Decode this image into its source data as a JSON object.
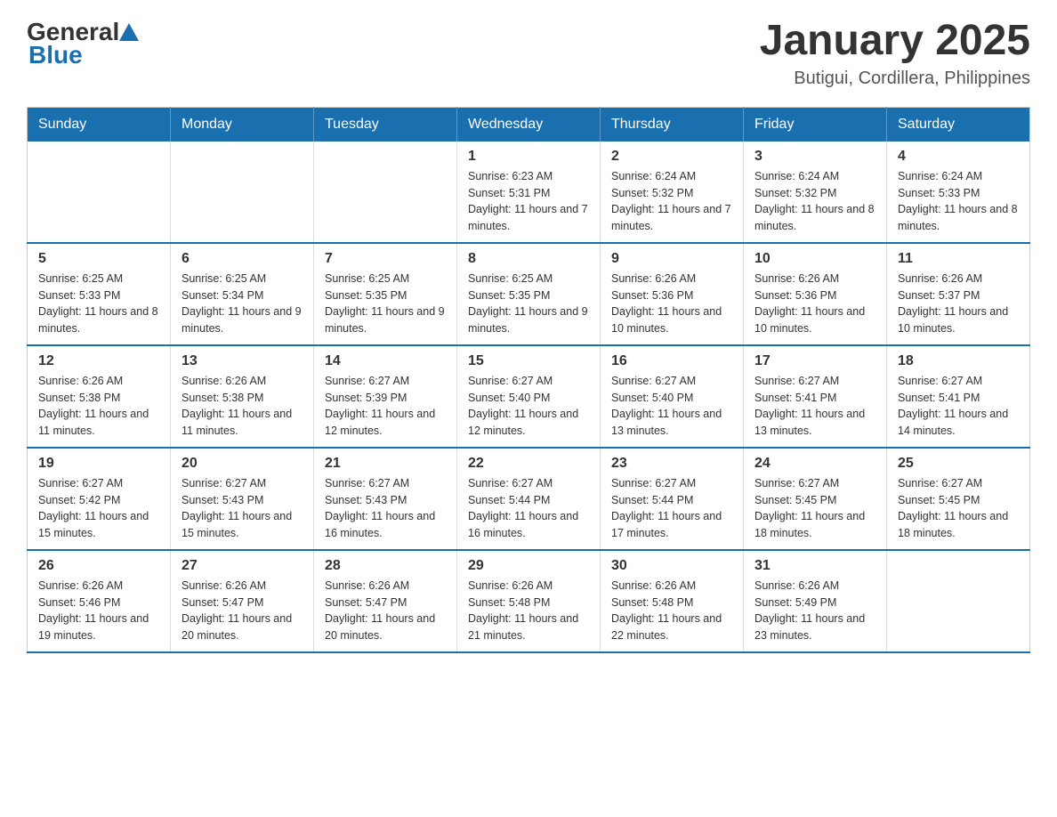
{
  "header": {
    "logo_general": "General",
    "logo_blue": "Blue",
    "month_title": "January 2025",
    "location": "Butigui, Cordillera, Philippines"
  },
  "days_of_week": [
    "Sunday",
    "Monday",
    "Tuesday",
    "Wednesday",
    "Thursday",
    "Friday",
    "Saturday"
  ],
  "weeks": [
    [
      {
        "day": "",
        "info": ""
      },
      {
        "day": "",
        "info": ""
      },
      {
        "day": "",
        "info": ""
      },
      {
        "day": "1",
        "info": "Sunrise: 6:23 AM\nSunset: 5:31 PM\nDaylight: 11 hours and 7 minutes."
      },
      {
        "day": "2",
        "info": "Sunrise: 6:24 AM\nSunset: 5:32 PM\nDaylight: 11 hours and 7 minutes."
      },
      {
        "day": "3",
        "info": "Sunrise: 6:24 AM\nSunset: 5:32 PM\nDaylight: 11 hours and 8 minutes."
      },
      {
        "day": "4",
        "info": "Sunrise: 6:24 AM\nSunset: 5:33 PM\nDaylight: 11 hours and 8 minutes."
      }
    ],
    [
      {
        "day": "5",
        "info": "Sunrise: 6:25 AM\nSunset: 5:33 PM\nDaylight: 11 hours and 8 minutes."
      },
      {
        "day": "6",
        "info": "Sunrise: 6:25 AM\nSunset: 5:34 PM\nDaylight: 11 hours and 9 minutes."
      },
      {
        "day": "7",
        "info": "Sunrise: 6:25 AM\nSunset: 5:35 PM\nDaylight: 11 hours and 9 minutes."
      },
      {
        "day": "8",
        "info": "Sunrise: 6:25 AM\nSunset: 5:35 PM\nDaylight: 11 hours and 9 minutes."
      },
      {
        "day": "9",
        "info": "Sunrise: 6:26 AM\nSunset: 5:36 PM\nDaylight: 11 hours and 10 minutes."
      },
      {
        "day": "10",
        "info": "Sunrise: 6:26 AM\nSunset: 5:36 PM\nDaylight: 11 hours and 10 minutes."
      },
      {
        "day": "11",
        "info": "Sunrise: 6:26 AM\nSunset: 5:37 PM\nDaylight: 11 hours and 10 minutes."
      }
    ],
    [
      {
        "day": "12",
        "info": "Sunrise: 6:26 AM\nSunset: 5:38 PM\nDaylight: 11 hours and 11 minutes."
      },
      {
        "day": "13",
        "info": "Sunrise: 6:26 AM\nSunset: 5:38 PM\nDaylight: 11 hours and 11 minutes."
      },
      {
        "day": "14",
        "info": "Sunrise: 6:27 AM\nSunset: 5:39 PM\nDaylight: 11 hours and 12 minutes."
      },
      {
        "day": "15",
        "info": "Sunrise: 6:27 AM\nSunset: 5:40 PM\nDaylight: 11 hours and 12 minutes."
      },
      {
        "day": "16",
        "info": "Sunrise: 6:27 AM\nSunset: 5:40 PM\nDaylight: 11 hours and 13 minutes."
      },
      {
        "day": "17",
        "info": "Sunrise: 6:27 AM\nSunset: 5:41 PM\nDaylight: 11 hours and 13 minutes."
      },
      {
        "day": "18",
        "info": "Sunrise: 6:27 AM\nSunset: 5:41 PM\nDaylight: 11 hours and 14 minutes."
      }
    ],
    [
      {
        "day": "19",
        "info": "Sunrise: 6:27 AM\nSunset: 5:42 PM\nDaylight: 11 hours and 15 minutes."
      },
      {
        "day": "20",
        "info": "Sunrise: 6:27 AM\nSunset: 5:43 PM\nDaylight: 11 hours and 15 minutes."
      },
      {
        "day": "21",
        "info": "Sunrise: 6:27 AM\nSunset: 5:43 PM\nDaylight: 11 hours and 16 minutes."
      },
      {
        "day": "22",
        "info": "Sunrise: 6:27 AM\nSunset: 5:44 PM\nDaylight: 11 hours and 16 minutes."
      },
      {
        "day": "23",
        "info": "Sunrise: 6:27 AM\nSunset: 5:44 PM\nDaylight: 11 hours and 17 minutes."
      },
      {
        "day": "24",
        "info": "Sunrise: 6:27 AM\nSunset: 5:45 PM\nDaylight: 11 hours and 18 minutes."
      },
      {
        "day": "25",
        "info": "Sunrise: 6:27 AM\nSunset: 5:45 PM\nDaylight: 11 hours and 18 minutes."
      }
    ],
    [
      {
        "day": "26",
        "info": "Sunrise: 6:26 AM\nSunset: 5:46 PM\nDaylight: 11 hours and 19 minutes."
      },
      {
        "day": "27",
        "info": "Sunrise: 6:26 AM\nSunset: 5:47 PM\nDaylight: 11 hours and 20 minutes."
      },
      {
        "day": "28",
        "info": "Sunrise: 6:26 AM\nSunset: 5:47 PM\nDaylight: 11 hours and 20 minutes."
      },
      {
        "day": "29",
        "info": "Sunrise: 6:26 AM\nSunset: 5:48 PM\nDaylight: 11 hours and 21 minutes."
      },
      {
        "day": "30",
        "info": "Sunrise: 6:26 AM\nSunset: 5:48 PM\nDaylight: 11 hours and 22 minutes."
      },
      {
        "day": "31",
        "info": "Sunrise: 6:26 AM\nSunset: 5:49 PM\nDaylight: 11 hours and 23 minutes."
      },
      {
        "day": "",
        "info": ""
      }
    ]
  ]
}
